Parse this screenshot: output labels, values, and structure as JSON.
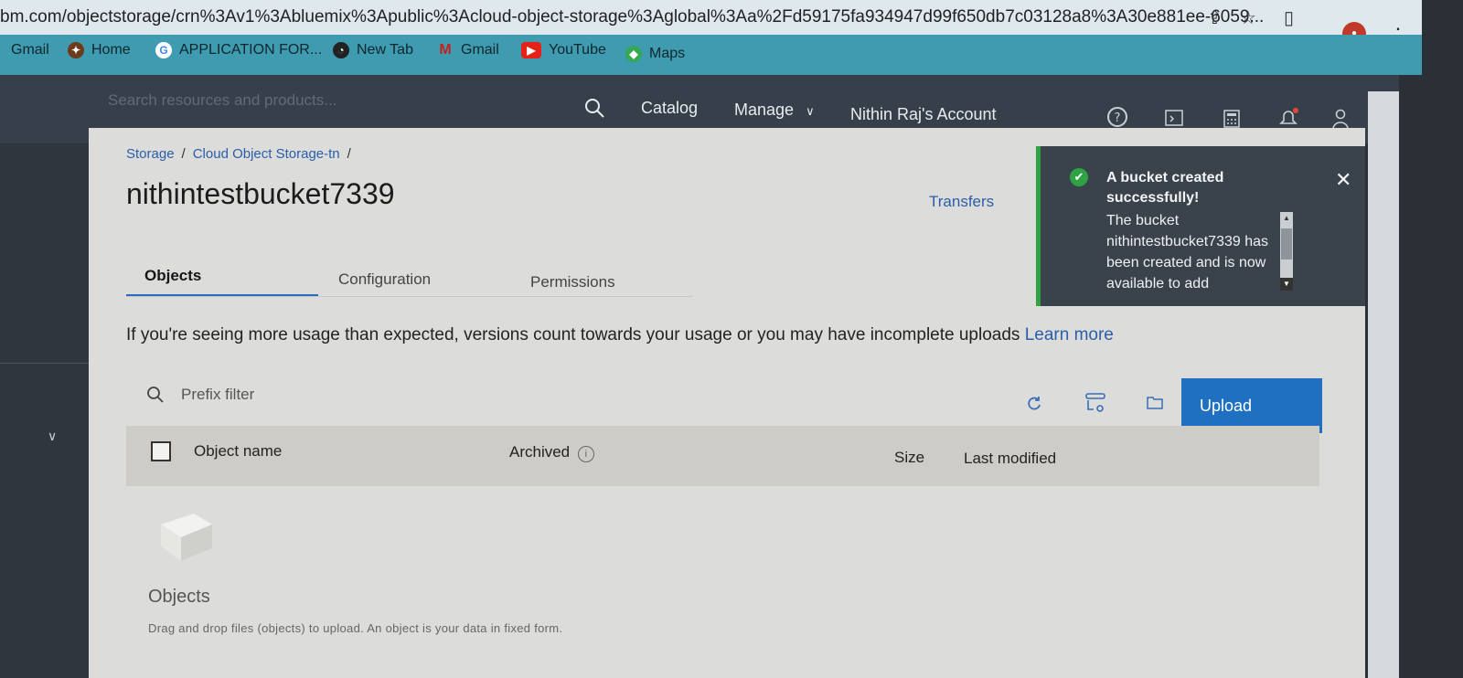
{
  "browser": {
    "url": "bm.com/objectstorage/crn%3Av1%3Abluemix%3Apublic%3Acloud-object-storage%3Aglobal%3Aa%2Fd59175fa934947d99f650db7c03128a8%3A30e881ee-6059...",
    "bookmarks": [
      "Gmail",
      "Home",
      "APPLICATION FOR...",
      "New Tab",
      "Gmail",
      "YouTube",
      "Maps"
    ]
  },
  "header": {
    "search_placeholder": "Search resources and products...",
    "catalog": "Catalog",
    "manage": "Manage",
    "account": "Nithin Raj's Account"
  },
  "page": {
    "breadcrumb": [
      "Storage",
      "Cloud Object Storage-tn"
    ],
    "title": "nithintestbucket7339",
    "transfers": "Transfers",
    "tabs": [
      "Objects",
      "Configuration",
      "Permissions"
    ]
  },
  "toast": {
    "title": "A bucket created successfully!",
    "body": "The bucket nithintestbucket7339 has been created and is now available to add"
  },
  "notice": {
    "text": "If you're seeing more usage than expected, versions count towards your usage or you may have incomplete uploads",
    "link": "Learn more"
  },
  "toolbar": {
    "prefix_placeholder": "Prefix filter",
    "upload": "Upload"
  },
  "table": {
    "columns": [
      "Object name",
      "Archived",
      "Size",
      "Last modified"
    ]
  },
  "empty_state": {
    "title": "Objects",
    "description": "Drag and drop files (objects) to upload. An object is your data in fixed form."
  }
}
